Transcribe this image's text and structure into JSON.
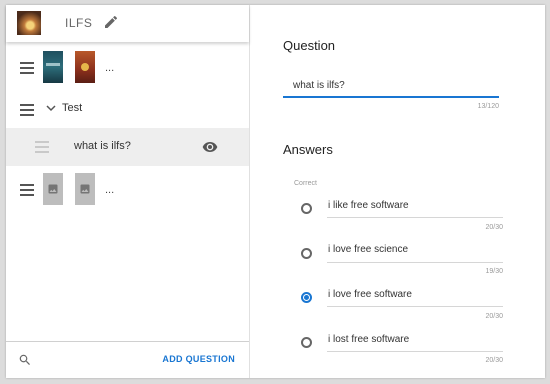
{
  "header": {
    "title": "ILFS"
  },
  "sidebar": {
    "items": [
      {
        "type": "image-question",
        "ellipsis": "..."
      },
      {
        "type": "section",
        "label": "Test"
      },
      {
        "type": "question",
        "label": "what is ilfs?"
      },
      {
        "type": "image-question",
        "ellipsis": "..."
      }
    ],
    "add_question_label": "ADD QUESTION"
  },
  "question": {
    "heading": "Question",
    "value": "what is ilfs?",
    "counter": "13/120"
  },
  "answers": {
    "heading": "Answers",
    "correct_label": "Correct",
    "items": [
      {
        "text": "i like free software",
        "counter": "20/30",
        "correct": false
      },
      {
        "text": "i love free science",
        "counter": "19/30",
        "correct": false
      },
      {
        "text": "i love free software",
        "counter": "20/30",
        "correct": true
      },
      {
        "text": "i lost free software",
        "counter": "20/30",
        "correct": false
      }
    ]
  },
  "colors": {
    "accent": "#1976d2",
    "selected_row": "#eeeeee"
  },
  "icons": [
    "edit-icon",
    "menu-icon",
    "chevron-down-icon",
    "eye-icon",
    "search-icon",
    "image-icon"
  ]
}
